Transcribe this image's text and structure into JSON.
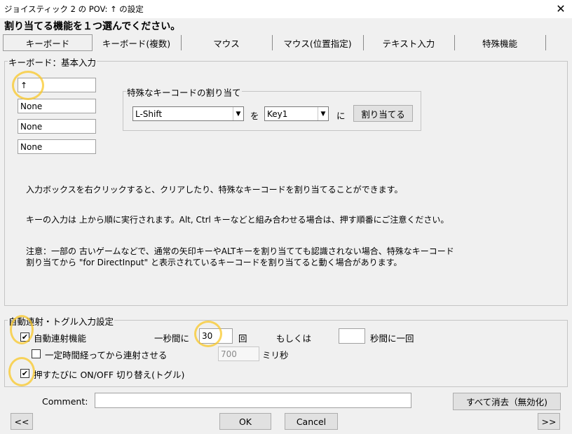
{
  "window": {
    "title": "ジョイスティック 2 の POV: ↑ の設定",
    "close_glyph": "✕"
  },
  "prompt": "割り当てる機能を１つ選んでください。",
  "tabs": [
    {
      "label": "キーボード",
      "active": true
    },
    {
      "label": "キーボード(複数)"
    },
    {
      "label": "マウス"
    },
    {
      "label": "マウス(位置指定)"
    },
    {
      "label": "テキスト入力"
    },
    {
      "label": "特殊機能"
    }
  ],
  "keyboard_group": {
    "legend": "キーボード：基本入力",
    "key_inputs": [
      "↑",
      "None",
      "None",
      "None"
    ],
    "special": {
      "legend": "特殊なキーコードの割り当て",
      "modifier_value": "L-Shift",
      "wo": "を",
      "key_value": "Key1",
      "ni": "に",
      "assign_button": "割り当てる"
    },
    "info": [
      "入力ボックスを右クリックすると、クリアしたり、特殊なキーコードを割り当てることができます。",
      "キーの入力は 上から順に実行されます。Alt, Ctrl キーなどと組み合わせる場合は、押す順番にご注意ください。",
      "注意：一部の 古いゲームなどで、通常の矢印キーやALTキーを割り当てても認識されない場合、特殊なキーコード",
      "割り当てから \"for DirectInput\" と表示されているキーコードを割り当てると動く場合があります。"
    ]
  },
  "auto_group": {
    "legend": "自動連射・トグル入力設定",
    "autofire_label": "自動連射機能",
    "autofire_checked": true,
    "per_second_label": "一秒間に",
    "per_second_value": "30",
    "times_label": "回",
    "or_label": "もしくは",
    "seconds_value": "",
    "per_once_label": "秒間に一回",
    "delay_label": "一定時間経ってから連射させる",
    "delay_checked": false,
    "delay_value": "700",
    "ms_label": "ミリ秒",
    "toggle_label": "押すたびに ON/OFF 切り替え(トグル)",
    "toggle_checked": true
  },
  "comment": {
    "label": "Comment:",
    "value": ""
  },
  "buttons": {
    "clear_all": "すべて消去（無効化)",
    "prev": "<<",
    "ok": "OK",
    "cancel": "Cancel",
    "next": ">>"
  },
  "colors": {
    "highlight_circle": "#f5c518"
  }
}
